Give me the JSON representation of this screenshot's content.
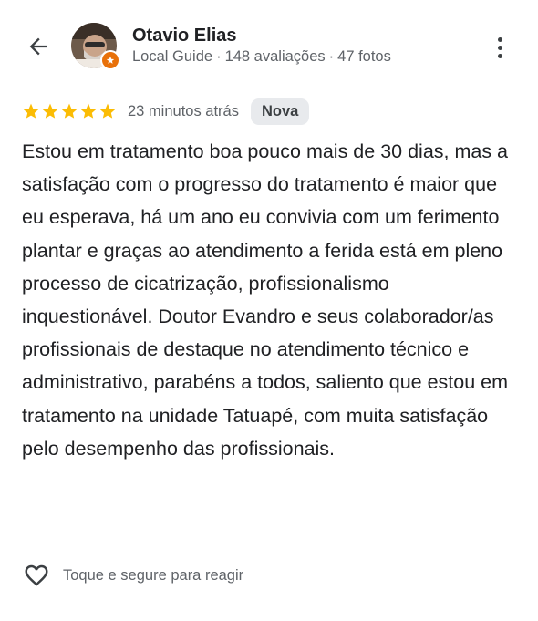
{
  "header": {
    "back_icon": "arrow-left-icon",
    "reviewer_name": "Otavio Elias",
    "reviewer_meta": {
      "level": "Local Guide",
      "reviews": "148 avaliações",
      "photos": "47 fotos",
      "separator": "·"
    },
    "avatar_badge_icon": "local-guide-star-icon",
    "more_icon": "more-vertical-icon",
    "badge_color": "#e8710a"
  },
  "review": {
    "stars": 5,
    "star_color": "#fbbc04",
    "time": "23 minutos atrás",
    "badge": "Nova",
    "text": "Estou em tratamento boa pouco mais de 30 dias, mas a satisfação com o progresso do tratamento é maior que eu esperava, há um ano eu convivia com um ferimento plantar e graças ao atendimento a ferida está em pleno processo de cicatrização, profissionalismo inquestionável. Doutor Evandro e seus colaborador/as profissionais de destaque no atendimento técnico e administrativo, parabéns a todos, saliento que estou em tratamento na unidade Tatuapé, com muita satisfação pelo desempenho das profissionais."
  },
  "reaction": {
    "icon": "heart-outline-icon",
    "label": "Toque e segure para reagir"
  }
}
